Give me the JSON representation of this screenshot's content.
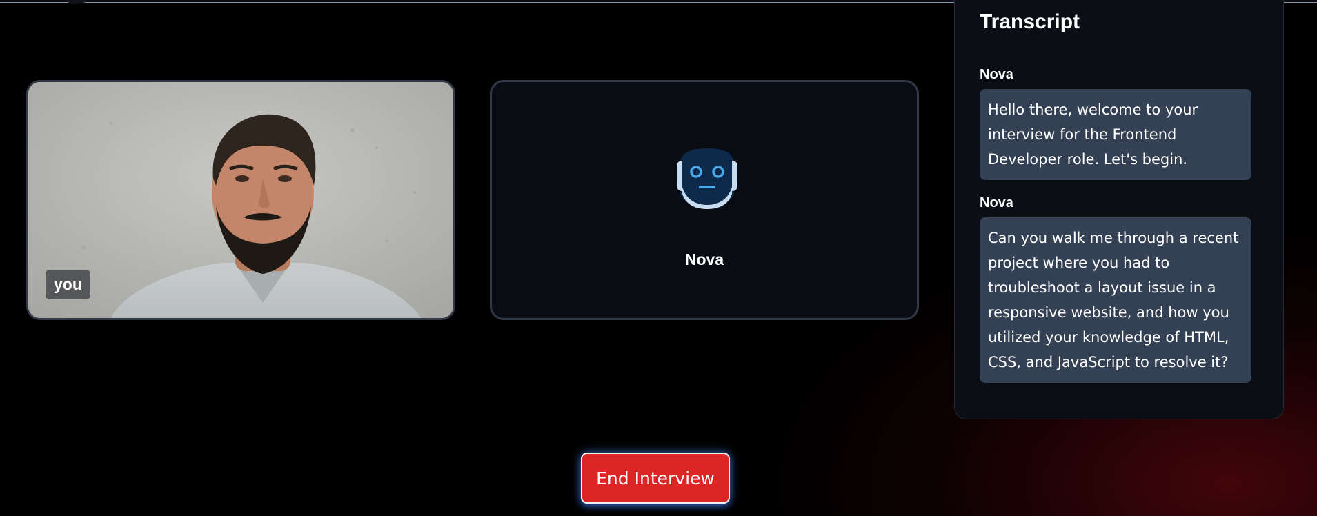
{
  "user_tile": {
    "label": "you"
  },
  "ai_tile": {
    "name": "Nova",
    "icon": "robot-face-icon"
  },
  "transcript": {
    "title": "Transcript",
    "messages": [
      {
        "speaker": "Nova",
        "text": "Hello there, welcome to your interview for the Frontend Developer role. Let's begin."
      },
      {
        "speaker": "Nova",
        "text": "Can you walk me through a recent project where you had to troubleshoot a layout issue in a responsive website, and how you utilized your knowledge of HTML, CSS, and JavaScript to resolve it?"
      }
    ]
  },
  "controls": {
    "end_label": "End Interview"
  },
  "colors": {
    "end_button": "#dc2525",
    "bubble": "#344154",
    "panel": "#0b0e15",
    "robot_face": "#0e2a4a",
    "robot_eyes": "#4aa8e8"
  }
}
